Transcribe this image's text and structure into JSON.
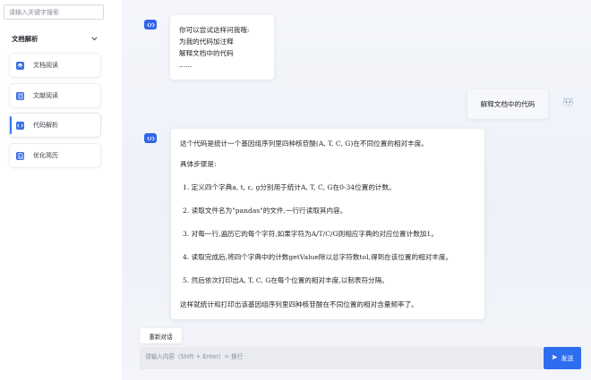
{
  "sidebar": {
    "search_placeholder": "请输入关键字搜索",
    "section_title": "文档解析",
    "items": [
      {
        "label": "文档阅读",
        "icon": "cube-icon"
      },
      {
        "label": "文献阅读",
        "icon": "book-icon"
      },
      {
        "label": "代码解析",
        "icon": "code-icon",
        "active": true
      },
      {
        "label": "优化简历",
        "icon": "file-icon"
      }
    ]
  },
  "chat": {
    "welcome": {
      "lines": [
        "你可以尝试这样问我哦:",
        "为我的代码加注释",
        "解释文档中的代码",
        "......"
      ]
    },
    "user_message": "解释文档中的代码",
    "answer": {
      "intro": "这个代码是统计一个基因组序列里四种核苷酸(A, T, C, G)在不同位置的相对丰度。",
      "steps_heading": "具体步骤是:",
      "steps": [
        "1. 定义四个字典a, t, c, g分别用于统计A, T, C, G在0-34位置的计数。",
        "2. 读取文件名为\"pandas\"的文件,一行行读取其内容。",
        "3. 对每一行,遍历它的每个字符,如果字符为A/T/C/G则相应字典的对应位置计数加1。",
        "4. 读取完成后,将四个字典中的计数getValue除以总字符数tol,得到在该位置的相对丰度。",
        "5. 然后依次打印出A, T, C, G在每个位置的相对丰度,以制表符分隔。"
      ],
      "outro": "这样就统计和打印出该基因组序列里四种核苷酸在不同位置的相对含量频率了。"
    }
  },
  "composer": {
    "reset_label": "重新对话",
    "placeholder": "请输入内容（Shift + Enter）= 换行",
    "send_label": "发送"
  },
  "colors": {
    "accent": "#2f6df0",
    "avatar_blue": "#2f63e8"
  }
}
